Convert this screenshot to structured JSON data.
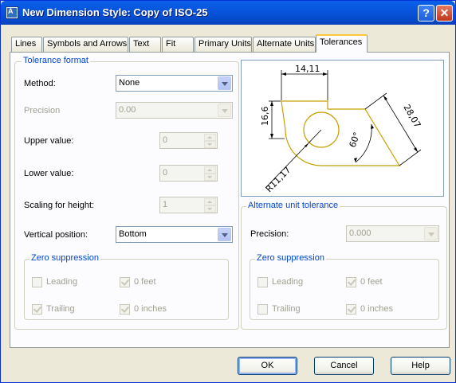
{
  "window": {
    "title": "New Dimension Style: Copy of ISO-25",
    "app_icon_glyph": "A",
    "help_glyph": "?",
    "close_glyph": "✕"
  },
  "tabs": [
    {
      "label": "Lines"
    },
    {
      "label": "Symbols and Arrows"
    },
    {
      "label": "Text"
    },
    {
      "label": "Fit"
    },
    {
      "label": "Primary Units"
    },
    {
      "label": "Alternate Units"
    },
    {
      "label": "Tolerances"
    }
  ],
  "active_tab": "Tolerances",
  "tolerance_format": {
    "group_label": "Tolerance format",
    "method": {
      "label": "Method:",
      "value": "None"
    },
    "precision": {
      "label": "Precision",
      "value": "0.00"
    },
    "upper_value": {
      "label": "Upper value:",
      "value": "0"
    },
    "lower_value": {
      "label": "Lower value:",
      "value": "0"
    },
    "scaling_for_height": {
      "label": "Scaling for height:",
      "value": "1"
    },
    "vertical_position": {
      "label": "Vertical position:",
      "value": "Bottom"
    }
  },
  "zero_suppression_primary": {
    "group_label": "Zero suppression",
    "leading": {
      "label": "Leading",
      "checked": false
    },
    "trailing": {
      "label": "Trailing",
      "checked": true
    },
    "feet": {
      "label": "0 feet",
      "checked": true
    },
    "inches": {
      "label": "0 inches",
      "checked": true
    }
  },
  "preview": {
    "dim_top": "14,11",
    "dim_left": "16,6",
    "dim_right": "28,07",
    "dim_angle": "60°",
    "dim_radius": "R11,17"
  },
  "alternate_unit_tolerance": {
    "group_label": "Alternate unit tolerance",
    "precision": {
      "label": "Precision:",
      "value": "0.000"
    }
  },
  "zero_suppression_alternate": {
    "group_label": "Zero suppression",
    "leading": {
      "label": "Leading",
      "checked": false
    },
    "trailing": {
      "label": "Trailing",
      "checked": false
    },
    "feet": {
      "label": "0 feet",
      "checked": true
    },
    "inches": {
      "label": "0 inches",
      "checked": true
    }
  },
  "buttons": {
    "ok": "OK",
    "cancel": "Cancel",
    "help": "Help"
  },
  "colors": {
    "titlebar": "#0855dd",
    "group_label": "#0046d5",
    "active_tab_accent": "#ffc83c",
    "preview_shape": "#c8a000"
  }
}
